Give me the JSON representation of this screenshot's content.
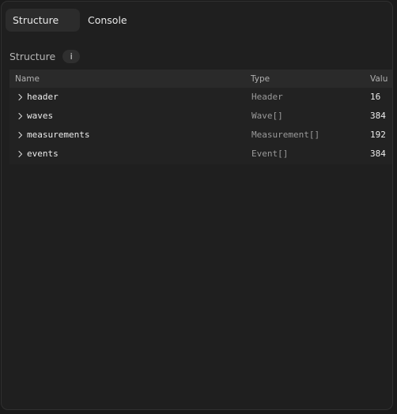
{
  "tabs": [
    {
      "label": "Structure",
      "active": true
    },
    {
      "label": "Console",
      "active": false
    }
  ],
  "section": {
    "title": "Structure",
    "info_label": "i"
  },
  "table": {
    "columns": {
      "name": "Name",
      "type": "Type",
      "value": "Valu"
    },
    "rows": [
      {
        "name": "header",
        "type": "Header",
        "value": "16"
      },
      {
        "name": "waves",
        "type": "Wave[]",
        "value": "384"
      },
      {
        "name": "measurements",
        "type": "Measurement[]",
        "value": "192"
      },
      {
        "name": "events",
        "type": "Event[]",
        "value": "384"
      }
    ]
  },
  "icons": {
    "row_expander": "chevron-right-icon"
  },
  "colors": {
    "panel_bg": "#1f1f1f",
    "active_tab_bg": "#2c2c2c",
    "table_header_bg": "#2a2a2a",
    "type_text": "#9a9a9a"
  }
}
